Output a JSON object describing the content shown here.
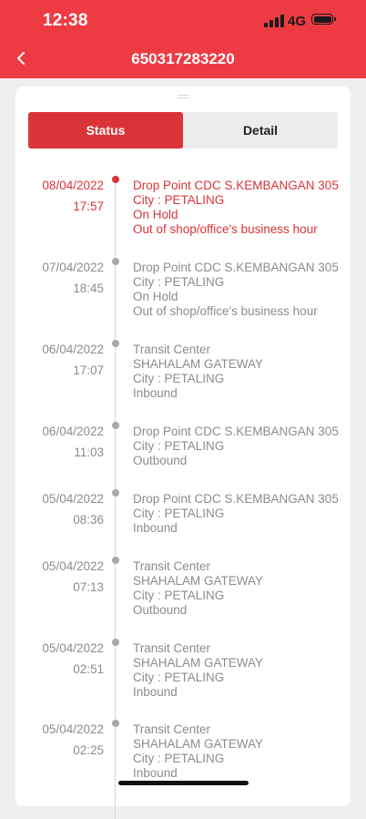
{
  "status_bar": {
    "time": "12:38",
    "network": "4G"
  },
  "header": {
    "title": "650317283220"
  },
  "tabs": [
    {
      "label": "Status",
      "selected": true
    },
    {
      "label": "Detail",
      "selected": false
    }
  ],
  "colors": {
    "header_red": "#ee3b43",
    "active_red": "#d93438",
    "muted_text": "#8c8c8c"
  },
  "timeline": [
    {
      "date": "08/04/2022",
      "time": "17:57",
      "active": true,
      "lines": [
        "Drop Point CDC S.KEMBANGAN 305",
        "City : PETALING",
        "On Hold",
        "Out of shop/office's business hour"
      ]
    },
    {
      "date": "07/04/2022",
      "time": "18:45",
      "lines": [
        "Drop Point CDC S.KEMBANGAN 305",
        "City : PETALING",
        "On Hold",
        "Out of shop/office's business hour"
      ]
    },
    {
      "date": "06/04/2022",
      "time": "17:07",
      "lines": [
        "Transit Center",
        "SHAHALAM GATEWAY",
        "City : PETALING",
        "Inbound"
      ]
    },
    {
      "date": "06/04/2022",
      "time": "11:03",
      "lines": [
        "Drop Point CDC S.KEMBANGAN 305",
        "City : PETALING",
        "Outbound"
      ]
    },
    {
      "date": "05/04/2022",
      "time": "08:36",
      "lines": [
        "Drop Point CDC S.KEMBANGAN 305",
        "City : PETALING",
        "Inbound"
      ]
    },
    {
      "date": "05/04/2022",
      "time": "07:13",
      "lines": [
        "Transit Center",
        "SHAHALAM GATEWAY",
        "City : PETALING",
        "Outbound"
      ]
    },
    {
      "date": "05/04/2022",
      "time": "02:51",
      "lines": [
        "Transit Center",
        "SHAHALAM GATEWAY",
        "City : PETALING",
        "Inbound"
      ]
    },
    {
      "date": "05/04/2022",
      "time": "02:25",
      "lines": [
        "Transit Center",
        "SHAHALAM GATEWAY",
        "City : PETALING",
        "Inbound"
      ]
    }
  ]
}
